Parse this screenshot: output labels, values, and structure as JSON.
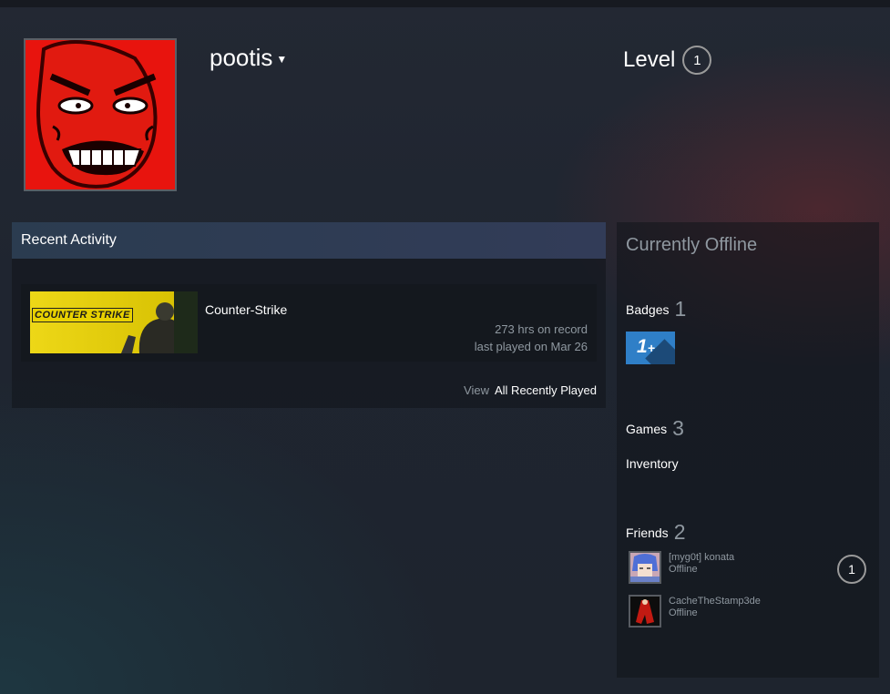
{
  "profile": {
    "persona_name": "pootis",
    "level_label": "Level",
    "level": "1"
  },
  "recent_activity": {
    "title": "Recent Activity",
    "game": {
      "name": "Counter-Strike",
      "capsule_text": "COUNTER STRIKE",
      "hours": "273 hrs on record",
      "last_played": "last played on Mar 26"
    },
    "view_label": "View",
    "all_recently_played": "All Recently Played"
  },
  "sidebar": {
    "status": "Currently Offline",
    "badges": {
      "label": "Badges",
      "count": "1",
      "badge_text": "1",
      "badge_plus": "+"
    },
    "games": {
      "label": "Games",
      "count": "3"
    },
    "inventory": "Inventory",
    "friends": {
      "label": "Friends",
      "count": "2",
      "list": [
        {
          "name": "[myg0t] konata",
          "status": "Offline",
          "level": "1"
        },
        {
          "name": "CacheTheStamp3de",
          "status": "Offline"
        }
      ]
    }
  },
  "colors": {
    "accent_blue": "#2f7fc7",
    "header_gradient": "#2b3c50",
    "muted_text": "#8f98a0"
  }
}
